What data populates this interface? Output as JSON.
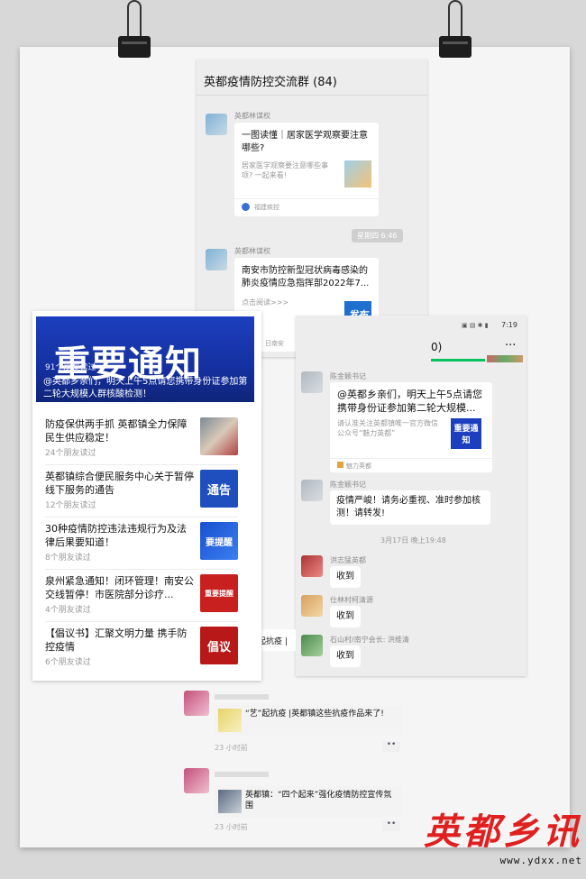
{
  "group_chat": {
    "title": "英都疫情防控交流群 (84)",
    "messages": [
      {
        "sender": "英都林谋权",
        "card_title": "一图读懂｜居家医学观察要注意哪些?",
        "card_desc": "居家医学观察要注意哪些事项? 一起来看!",
        "card_source": "福建疾控"
      },
      {
        "sender": "英都林谋权",
        "time": "星期四 6:46",
        "card_title": "南安市防控新型冠状病毒感染的肺炎疫情应急指挥部2022年7...",
        "card_desc": "点击阅读>>>",
        "card_source": "日南安",
        "thumb_text": "发布"
      }
    ]
  },
  "news_list": {
    "banner_title": "重要通知",
    "banner_count": "91个朋友读过",
    "banner_text": "@英都乡亲们，明天上午5点请您携带身份证参加第二轮大规模人群核酸检测！",
    "items": [
      {
        "title": "防疫保供两手抓 英都镇全力保障民生供应稳定！",
        "meta": "24个朋友读过",
        "thumb": ""
      },
      {
        "title": "英都镇综合便民服务中心关于暂停线下服务的通告",
        "meta": "12个朋友读过",
        "thumb": "通告"
      },
      {
        "title": "30种疫情防控违法违规行为及法律后果要知道！",
        "meta": "8个朋友读过",
        "thumb": "要提醒"
      },
      {
        "title": "泉州紧急通知！闭环管理！南安公交线暂停！市医院部分诊疗...",
        "meta": "4个朋友读过",
        "thumb": "重要提醒"
      },
      {
        "title": "【倡议书】汇聚文明力量 携手防控疫情",
        "meta": "6个朋友读过",
        "thumb": "倡议"
      }
    ]
  },
  "phone_chat": {
    "status_time": "7:19",
    "header_fragment": "0)",
    "more_label": "···",
    "messages": [
      {
        "sender": "陈金颖书记",
        "text": "@英都乡亲们，明天上午5点请您携带身份证参加第二轮大规模...",
        "card_desc": "请认准关注英都镇唯一官方微信公众号“魅力英都”",
        "card_source": "魅力英都",
        "thumb_text": "重要通知"
      },
      {
        "sender": "陈金颖书记",
        "text": "疫情严峻！请务必重视、准时参加核测！请转发!"
      }
    ],
    "timestamp": "3月17日 晚上19:48",
    "replies": [
      {
        "sender": "洪志猛英都",
        "text": "收到"
      },
      {
        "sender": "仕林村柯清源",
        "text": "收到"
      },
      {
        "sender": "石山村/南宁会长: 洪维清",
        "text": "收到"
      }
    ],
    "left_fragment": "起抗疫 |"
  },
  "moments": [
    {
      "text": "“艺”起抗疫 |英都镇这些抗疫作品来了!",
      "time": "23 小时前",
      "dots": "••"
    },
    {
      "text": "英都镇：“四个起来”强化疫情防控宣传氛围",
      "time": "23 小时前",
      "dots": "••"
    }
  ],
  "watermark": {
    "title": "英都乡讯",
    "url": "www.ydxx.net"
  }
}
